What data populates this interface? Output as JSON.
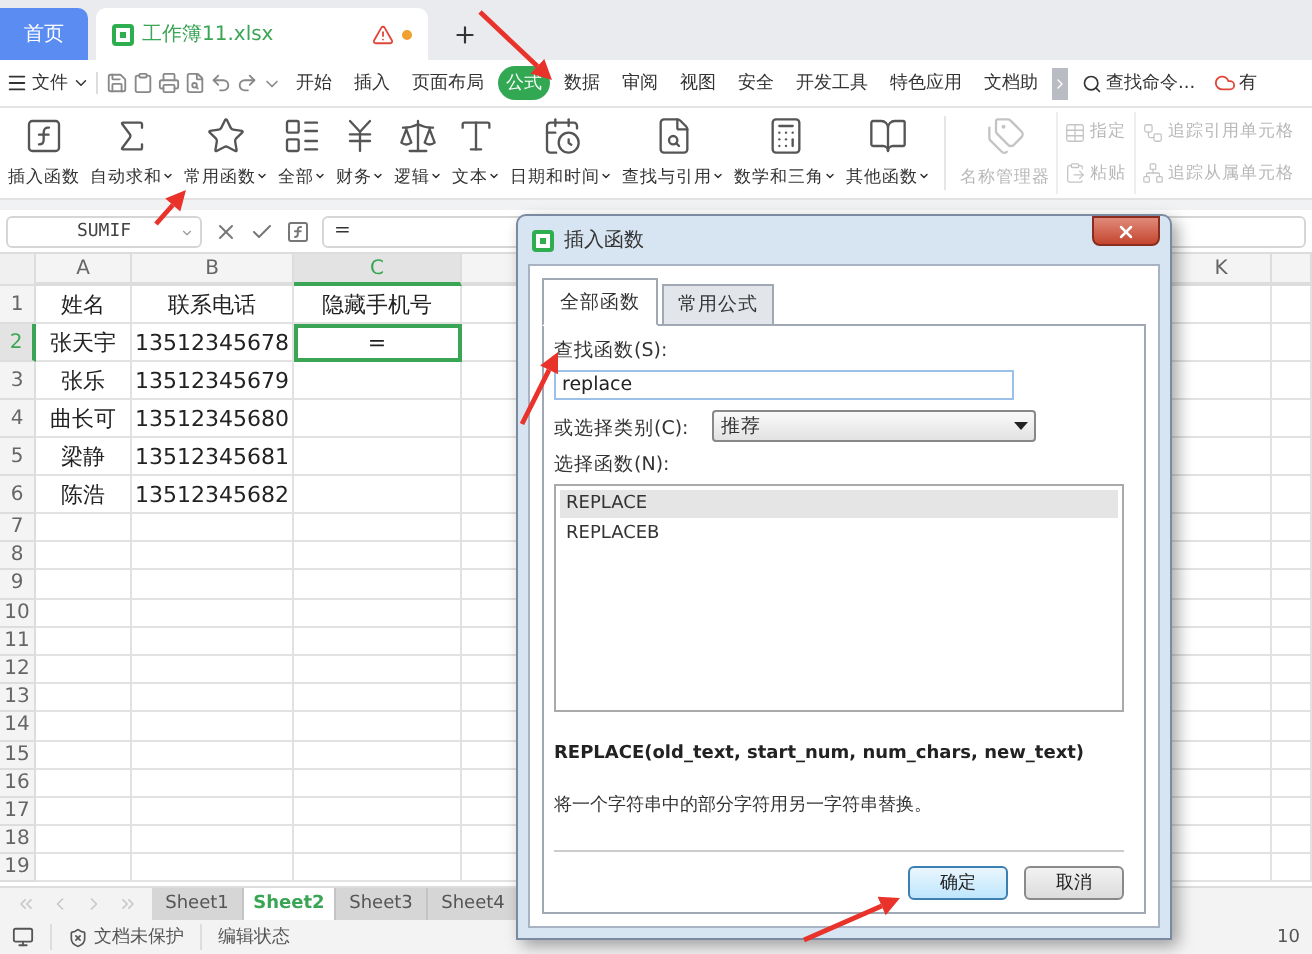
{
  "tab_bar": {
    "home_tab": "首页",
    "file_tab": {
      "name": "工作簿11.xlsx",
      "warning": true,
      "unsaved": true
    }
  },
  "menu": {
    "file": "文件",
    "items": [
      {
        "label": "开始",
        "selected": false
      },
      {
        "label": "插入",
        "selected": false
      },
      {
        "label": "页面布局",
        "selected": false
      },
      {
        "label": "公式",
        "selected": true
      },
      {
        "label": "数据",
        "selected": false
      },
      {
        "label": "审阅",
        "selected": false
      },
      {
        "label": "视图",
        "selected": false
      },
      {
        "label": "安全",
        "selected": false
      },
      {
        "label": "开发工具",
        "selected": false
      },
      {
        "label": "特色应用",
        "selected": false
      },
      {
        "label": "文档助",
        "selected": false
      }
    ],
    "search": "查找命令...",
    "account": "有"
  },
  "ribbon": {
    "buttons": [
      {
        "kind": "large",
        "label": "插入函数",
        "has_menu": false,
        "disabled": false
      },
      {
        "kind": "large",
        "label": "自动求和",
        "has_menu": true,
        "disabled": false
      },
      {
        "kind": "large",
        "label": "常用函数",
        "has_menu": true,
        "disabled": false
      },
      {
        "kind": "large",
        "label": "全部",
        "has_menu": true,
        "disabled": false
      },
      {
        "kind": "large",
        "label": "财务",
        "has_menu": true,
        "disabled": false
      },
      {
        "kind": "large",
        "label": "逻辑",
        "has_menu": true,
        "disabled": false
      },
      {
        "kind": "large",
        "label": "文本",
        "has_menu": true,
        "disabled": false
      },
      {
        "kind": "large",
        "label": "日期和时间",
        "has_menu": true,
        "disabled": false
      },
      {
        "kind": "large",
        "label": "查找与引用",
        "has_menu": true,
        "disabled": false
      },
      {
        "kind": "large",
        "label": "数学和三角",
        "has_menu": true,
        "disabled": false
      },
      {
        "kind": "large",
        "label": "其他函数",
        "has_menu": true,
        "disabled": false
      },
      {
        "kind": "large",
        "label": "名称管理器",
        "has_menu": false,
        "disabled": true
      },
      {
        "kind": "small",
        "label": "指定",
        "has_menu": false,
        "disabled": true
      },
      {
        "kind": "small",
        "label": "粘贴",
        "has_menu": false,
        "disabled": true
      },
      {
        "kind": "small",
        "label": "追踪引用单元格",
        "has_menu": false,
        "disabled": true
      },
      {
        "kind": "small",
        "label": "追踪从属单元格",
        "has_menu": false,
        "disabled": true
      }
    ]
  },
  "formula_bar": {
    "name_box": "SUMIF",
    "formula": "="
  },
  "sheet": {
    "columns": [
      {
        "label": "A",
        "active": false
      },
      {
        "label": "B",
        "active": false
      },
      {
        "label": "C",
        "active": true
      },
      {
        "label": "K",
        "active": false
      }
    ],
    "rows": [
      {
        "number": "1",
        "active": false,
        "cells": [
          "姓名",
          "联系电话",
          "隐藏手机号"
        ]
      },
      {
        "number": "2",
        "active": true,
        "cells": [
          "张天宇",
          "13512345678",
          "="
        ]
      },
      {
        "number": "3",
        "active": false,
        "cells": [
          "张乐",
          "13512345679"
        ]
      },
      {
        "number": "4",
        "active": false,
        "cells": [
          "曲长可",
          "13512345680"
        ]
      },
      {
        "number": "5",
        "active": false,
        "cells": [
          "梁静",
          "13512345681"
        ]
      },
      {
        "number": "6",
        "active": false,
        "cells": [
          "陈浩",
          "13512345682"
        ]
      },
      {
        "number": "7",
        "active": false
      },
      {
        "number": "8",
        "active": false
      },
      {
        "number": "9",
        "active": false
      },
      {
        "number": "10",
        "active": false
      },
      {
        "number": "11",
        "active": false
      },
      {
        "number": "12",
        "active": false
      },
      {
        "number": "13",
        "active": false
      },
      {
        "number": "14",
        "active": false
      },
      {
        "number": "15",
        "active": false
      },
      {
        "number": "16",
        "active": false
      },
      {
        "number": "17",
        "active": false
      },
      {
        "number": "18",
        "active": false
      },
      {
        "number": "19",
        "active": false
      }
    ]
  },
  "sheet_tabs": [
    {
      "label": "Sheet1",
      "selected": false
    },
    {
      "label": "Sheet2",
      "selected": true
    },
    {
      "label": "Sheet3",
      "selected": false
    },
    {
      "label": "Sheet4",
      "selected": false
    }
  ],
  "status_bar": {
    "protection": "文档未保护",
    "mode": "编辑状态",
    "zoom": "10"
  },
  "dialog": {
    "title": "插入函数",
    "tabs": [
      {
        "label": "全部函数",
        "selected": true
      },
      {
        "label": "常用公式",
        "selected": false
      }
    ],
    "search_label": "查找函数(S):",
    "search_value": "replace",
    "category_label": "或选择类别(C):",
    "category_value": "推荐",
    "list_label": "选择函数(N):",
    "functions": [
      {
        "name": "REPLACE",
        "selected": true
      },
      {
        "name": "REPLACEB",
        "selected": false
      }
    ],
    "signature": "REPLACE(old_text, start_num, num_chars, new_text)",
    "description": "将一个字符串中的部分字符用另一字符串替换。",
    "buttons": [
      {
        "label": "确定",
        "default": true
      },
      {
        "label": "取消",
        "default": false
      }
    ]
  }
}
